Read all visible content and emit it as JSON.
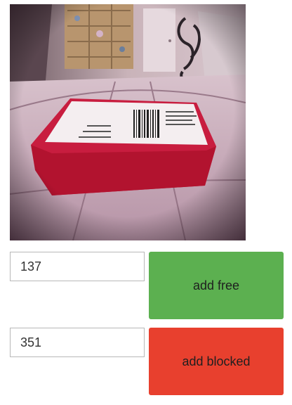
{
  "camera": {
    "label_free": "",
    "icon": "robot-camera-feed"
  },
  "controls": {
    "free": {
      "value": "137",
      "button_label": "add free",
      "color": "#5cb050"
    },
    "blocked": {
      "value": "351",
      "button_label": "add blocked",
      "color": "#e8402e"
    }
  }
}
